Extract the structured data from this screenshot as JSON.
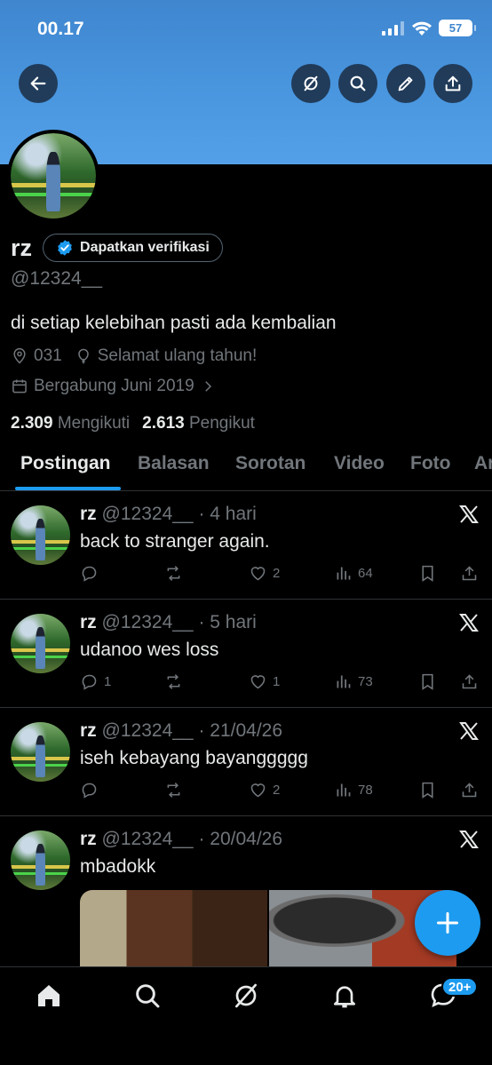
{
  "status_bar": {
    "time": "00.17",
    "battery": "57"
  },
  "header_buttons": [
    "back-icon",
    "grok-icon",
    "search-icon",
    "edit-icon",
    "share-icon"
  ],
  "profile": {
    "display_name": "rz",
    "verify_label": "Dapatkan verifikasi",
    "handle": "@12324__",
    "bio": "di setiap kelebihan pasti ada kembalian",
    "location": "031",
    "birthday": "Selamat ulang tahun!",
    "joined": "Bergabung Juni 2019",
    "following_count": "2.309",
    "following_label": "Mengikuti",
    "followers_count": "2.613",
    "followers_label": "Pengikut"
  },
  "tabs": [
    "Postingan",
    "Balasan",
    "Sorotan",
    "Video",
    "Foto",
    "Ar"
  ],
  "posts": [
    {
      "name": "rz",
      "handle": "@12324__",
      "time": "· 4 hari",
      "text": "back to stranger again.",
      "replies": "",
      "likes": "2",
      "views": "64"
    },
    {
      "name": "rz",
      "handle": "@12324__",
      "time": "· 5 hari",
      "text": "udanoo wes loss",
      "replies": "1",
      "likes": "1",
      "views": "73"
    },
    {
      "name": "rz",
      "handle": "@12324__",
      "time": "· 21/04/26",
      "text": "iseh kebayang bayanggggg",
      "replies": "",
      "likes": "2",
      "views": "78"
    },
    {
      "name": "rz",
      "handle": "@12324__",
      "time": "· 20/04/26",
      "text": "mbadokk"
    }
  ],
  "bottom_nav": {
    "messages_badge": "20+"
  },
  "colors": {
    "accent": "#1d9bf0",
    "banner": "#4a97e0",
    "muted": "#71767b"
  }
}
